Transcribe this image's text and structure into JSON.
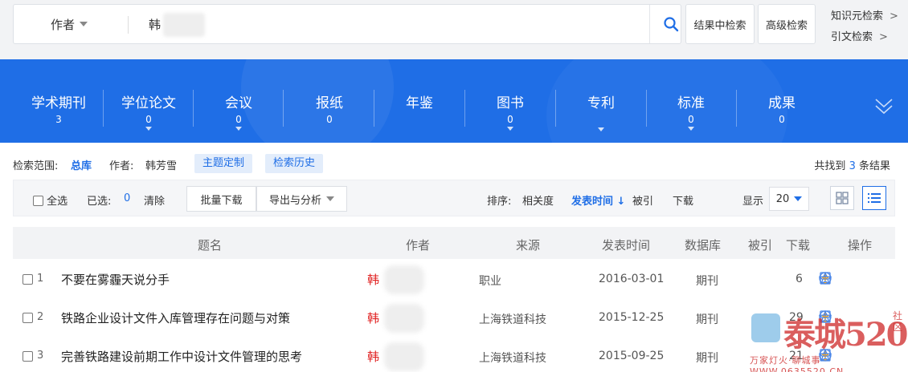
{
  "search": {
    "field": "作者",
    "query": "韩",
    "search_btn_icon": "search-icon",
    "in_results_label": "结果中检索",
    "advanced_label": "高级检索",
    "knowledge_label": "知识元检索",
    "citation_label": "引文检索",
    "link_arrow": ">"
  },
  "categories": [
    {
      "label": "学术期刊",
      "count": "3"
    },
    {
      "label": "学位论文",
      "count": "0"
    },
    {
      "label": "会议",
      "count": "0"
    },
    {
      "label": "报纸",
      "count": "0"
    },
    {
      "label": "年鉴",
      "count": ""
    },
    {
      "label": "图书",
      "count": "0"
    },
    {
      "label": "专利",
      "count": ""
    },
    {
      "label": "标准",
      "count": "0"
    },
    {
      "label": "成果",
      "count": "0"
    }
  ],
  "scope": {
    "range_label": "检索范围:",
    "range_value": "总库",
    "author_label": "作者:",
    "author_value": "韩芳雪",
    "topic_chip": "主题定制",
    "history_chip": "检索历史",
    "count_prefix": "共找到",
    "count_value": "3",
    "count_suffix": "条结果"
  },
  "toolbar": {
    "select_all": "全选",
    "selected_label": "已选:",
    "selected_count": "0",
    "clear": "清除",
    "batch_download": "批量下载",
    "export_analysis": "导出与分析",
    "sort_label": "排序:",
    "sort_relevance": "相关度",
    "sort_date": "发表时间",
    "sort_cited": "被引",
    "sort_download": "下载",
    "display_label": "显示",
    "page_size": "20"
  },
  "table": {
    "headers": {
      "title": "题名",
      "author": "作者",
      "source": "来源",
      "date": "发表时间",
      "db": "数据库",
      "cited": "被引",
      "download": "下载",
      "ops": "操作"
    },
    "rows": [
      {
        "num": "1",
        "title": "不要在雾霾天说分手",
        "author": "韩",
        "source": "职业",
        "date": "2016-03-01",
        "db": "期刊",
        "download": "6"
      },
      {
        "num": "2",
        "title": "铁路企业设计文件入库管理存在问题与对策",
        "author": "韩",
        "source": "上海铁道科技",
        "date": "2015-12-25",
        "db": "期刊",
        "download": "29"
      },
      {
        "num": "3",
        "title": "完善铁路建设前期工作中设计文件管理的思考",
        "author": "韩",
        "source": "上海铁道科技",
        "date": "2015-09-25",
        "db": "期刊",
        "download": "21"
      }
    ]
  },
  "watermark": {
    "main": "泰城520",
    "side": "社区",
    "sub": "万家灯火·聊城事 WWW.0635520.CN"
  },
  "colors": {
    "brand_blue": "#1f6ee6",
    "author_red": "#e02020",
    "download_orange": "#f5a623"
  }
}
